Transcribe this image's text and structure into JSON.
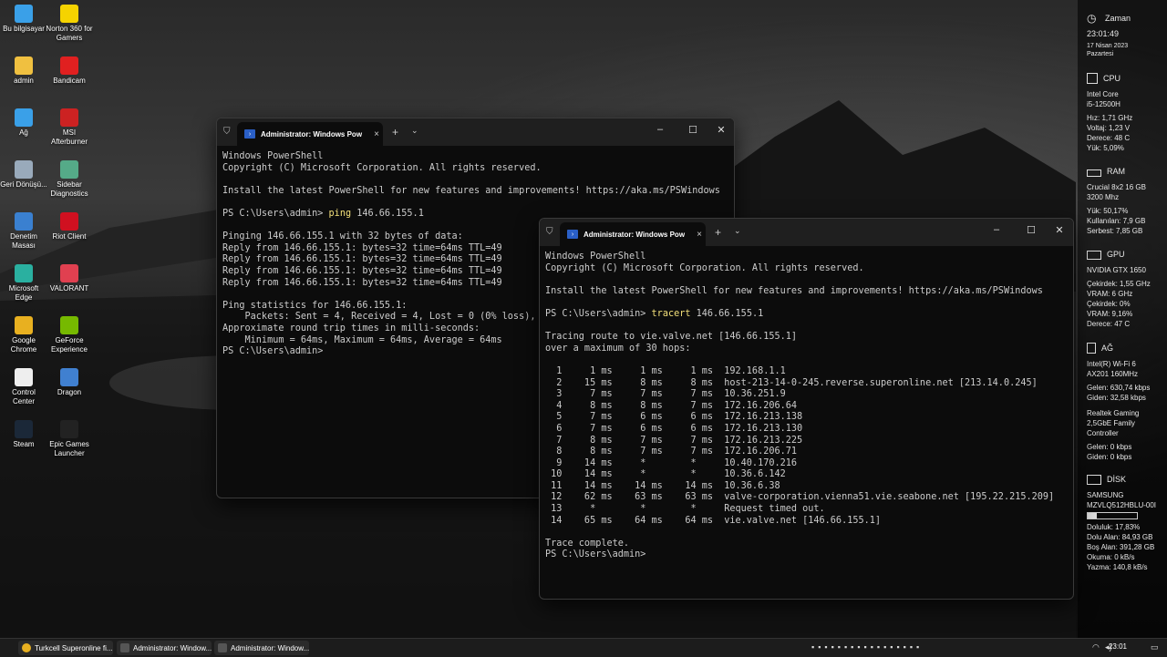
{
  "desktop_icons": [
    {
      "label": "Bu bilgisayar",
      "icon": "computer-icon",
      "color": "#3aa0e8"
    },
    {
      "label": "Norton 360 for Gamers",
      "icon": "norton-icon",
      "color": "#f5d300"
    },
    {
      "label": "admin",
      "icon": "folder-icon",
      "color": "#f0c040"
    },
    {
      "label": "Bandicam",
      "icon": "bandicam-icon",
      "color": "#e02020"
    },
    {
      "label": "Ağ",
      "icon": "network-icon",
      "color": "#3aa0e8"
    },
    {
      "label": "MSI Afterburner",
      "icon": "msi-icon",
      "color": "#cc2222"
    },
    {
      "label": "Geri Dönüşü...",
      "icon": "recycle-bin-icon",
      "color": "#9ab"
    },
    {
      "label": "Sidebar Diagnostics",
      "icon": "sidebar-diagnostics-icon",
      "color": "#5a8"
    },
    {
      "label": "Denetim Masası",
      "icon": "control-panel-icon",
      "color": "#3a80d0"
    },
    {
      "label": "Riot Client",
      "icon": "riot-icon",
      "color": "#d01020"
    },
    {
      "label": "Microsoft Edge",
      "icon": "edge-icon",
      "color": "#2ab0a0"
    },
    {
      "label": "VALORANT",
      "icon": "valorant-icon",
      "color": "#e04050"
    },
    {
      "label": "Google Chrome",
      "icon": "chrome-icon",
      "color": "#e8b020"
    },
    {
      "label": "GeForce Experience",
      "icon": "geforce-icon",
      "color": "#76b900"
    },
    {
      "label": "Control Center",
      "icon": "control-center-icon",
      "color": "#eeeeee"
    },
    {
      "label": "Dragon",
      "icon": "dragon-icon",
      "color": "#4080d0"
    },
    {
      "label": "Steam",
      "icon": "steam-icon",
      "color": "#1b2838"
    },
    {
      "label": "Epic Games Launcher",
      "icon": "epic-icon",
      "color": "#222222"
    }
  ],
  "sidebar": {
    "time": {
      "title": "Zaman",
      "clock": "23:01:49",
      "date": "17 Nisan 2023",
      "day": "Pazartesi"
    },
    "cpu": {
      "title": "CPU",
      "lines": [
        "Intel Core",
        "i5-12500H"
      ],
      "stats": [
        "Hız: 1,71 GHz",
        "Voltaj: 1,23 V",
        "Derece: 48 C",
        "Yük: 5,09%"
      ]
    },
    "ram": {
      "title": "RAM",
      "lines": [
        "Crucial 8x2 16 GB",
        "3200 Mhz"
      ],
      "stats": [
        "Yük: 50,17%",
        "Kullanılan: 7,9 GB",
        "Serbest: 7,85 GB"
      ]
    },
    "gpu": {
      "title": "GPU",
      "lines": [
        "NVIDIA GTX 1650"
      ],
      "stats": [
        "Çekirdek: 1,55 GHz",
        "VRAM: 6 GHz",
        "Çekirdek: 0%",
        "VRAM: 9,16%",
        "Derece: 47 C"
      ]
    },
    "net": {
      "title": "AĞ",
      "lines": [
        "Intel(R) Wi-Fi 6",
        "AX201 160MHz"
      ],
      "stats": [
        "Gelen: 630,74 kbps",
        "Giden: 32,58 kbps"
      ],
      "lines2": [
        "Realtek Gaming",
        "2,5GbE Family",
        "Controller"
      ],
      "stats2": [
        "Gelen: 0 kbps",
        "Giden: 0 kbps"
      ]
    },
    "disk": {
      "title": "DİSK",
      "lines": [
        "SAMSUNG",
        "MZVLQ512HBLU-00I"
      ],
      "usage_fraction": 0.1783,
      "stats": [
        "Doluluk: 17,83%",
        "Dolu Alan: 84,93 GB",
        "Boş Alan: 391,28 GB",
        "Okuma: 0 kB/s",
        "Yazma: 140,8 kB/s"
      ]
    }
  },
  "window1": {
    "tab_title": "Administrator: Windows Pow",
    "lines": [
      {
        "t": "Windows PowerShell"
      },
      {
        "t": "Copyright (C) Microsoft Corporation. All rights reserved."
      },
      {
        "t": ""
      },
      {
        "t": "Install the latest PowerShell for new features and improvements! https://aka.ms/PSWindows"
      },
      {
        "t": ""
      },
      {
        "t": "PS C:\\Users\\admin> ",
        "cmd": "ping",
        "rest": " 146.66.155.1"
      },
      {
        "t": ""
      },
      {
        "t": "Pinging 146.66.155.1 with 32 bytes of data:"
      },
      {
        "t": "Reply from 146.66.155.1: bytes=32 time=64ms TTL=49"
      },
      {
        "t": "Reply from 146.66.155.1: bytes=32 time=64ms TTL=49"
      },
      {
        "t": "Reply from 146.66.155.1: bytes=32 time=64ms TTL=49"
      },
      {
        "t": "Reply from 146.66.155.1: bytes=32 time=64ms TTL=49"
      },
      {
        "t": ""
      },
      {
        "t": "Ping statistics for 146.66.155.1:"
      },
      {
        "t": "    Packets: Sent = 4, Received = 4, Lost = 0 (0% loss),"
      },
      {
        "t": "Approximate round trip times in milli-seconds:"
      },
      {
        "t": "    Minimum = 64ms, Maximum = 64ms, Average = 64ms"
      },
      {
        "t": "PS C:\\Users\\admin>"
      }
    ]
  },
  "window2": {
    "tab_title": "Administrator: Windows Pow",
    "lines": [
      {
        "t": "Windows PowerShell"
      },
      {
        "t": "Copyright (C) Microsoft Corporation. All rights reserved."
      },
      {
        "t": ""
      },
      {
        "t": "Install the latest PowerShell for new features and improvements! https://aka.ms/PSWindows"
      },
      {
        "t": ""
      },
      {
        "t": "PS C:\\Users\\admin> ",
        "cmd": "tracert",
        "rest": " 146.66.155.1"
      },
      {
        "t": ""
      },
      {
        "t": "Tracing route to vie.valve.net [146.66.155.1]"
      },
      {
        "t": "over a maximum of 30 hops:"
      },
      {
        "t": ""
      },
      {
        "t": "  1     1 ms     1 ms     1 ms  192.168.1.1"
      },
      {
        "t": "  2    15 ms     8 ms     8 ms  host-213-14-0-245.reverse.superonline.net [213.14.0.245]"
      },
      {
        "t": "  3     7 ms     7 ms     7 ms  10.36.251.9"
      },
      {
        "t": "  4     8 ms     8 ms     7 ms  172.16.206.64"
      },
      {
        "t": "  5     7 ms     6 ms     6 ms  172.16.213.138"
      },
      {
        "t": "  6     7 ms     6 ms     6 ms  172.16.213.130"
      },
      {
        "t": "  7     8 ms     7 ms     7 ms  172.16.213.225"
      },
      {
        "t": "  8     8 ms     7 ms     7 ms  172.16.206.71"
      },
      {
        "t": "  9    14 ms     *        *     10.40.170.216"
      },
      {
        "t": " 10    14 ms     *        *     10.36.6.142"
      },
      {
        "t": " 11    14 ms    14 ms    14 ms  10.36.6.38"
      },
      {
        "t": " 12    62 ms    63 ms    63 ms  valve-corporation.vienna51.vie.seabone.net [195.22.215.209]"
      },
      {
        "t": " 13     *        *        *     Request timed out."
      },
      {
        "t": " 14    65 ms    64 ms    64 ms  vie.valve.net [146.66.155.1]"
      },
      {
        "t": ""
      },
      {
        "t": "Trace complete."
      },
      {
        "t": "PS C:\\Users\\admin>"
      }
    ]
  },
  "taskbar": {
    "items": [
      {
        "label": "Turkcell Superonline fi...",
        "icon": "chrome-icon",
        "color": "#e8b020"
      },
      {
        "label": "Administrator: Window...",
        "icon": "terminal-icon",
        "color": "#444"
      },
      {
        "label": "Administrator: Window...",
        "icon": "terminal-icon",
        "color": "#444"
      }
    ],
    "clock": "23:01"
  }
}
